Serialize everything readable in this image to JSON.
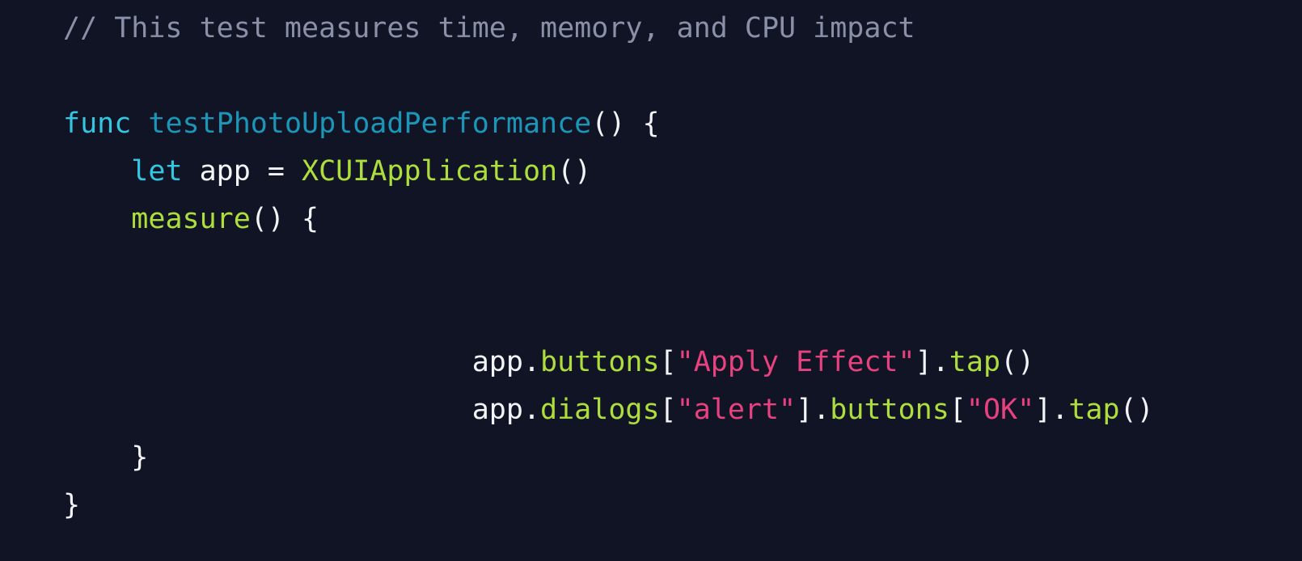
{
  "editor": {
    "background_color": "#111425",
    "font_size_px": 35,
    "line_height_px": 59,
    "language": "swift"
  },
  "theme": {
    "comment_color": "#8b90a8",
    "keyword_color": "#34c5e0",
    "function_name_color": "#1b96b8",
    "method_color": "#aede3c",
    "type_color": "#aede3c",
    "string_color": "#e8417f",
    "plain_color": "#f2f4f8",
    "background_color": "#111425"
  },
  "code": {
    "full_text": "// This test measures time, memory, and CPU impact\n\nfunc testPhotoUploadPerformance() {\n    let app = XCUIApplication()\n    measure() {\n\n\n                        app.buttons[\"Apply Effect\"].tap()\n                        app.dialogs[\"alert\"].buttons[\"OK\"].tap()\n    }\n}",
    "lines": [
      {
        "index": 1,
        "indent": 0,
        "text": "// This test measures time, memory, and CPU impact",
        "tokens": [
          {
            "t": "// This test measures time, memory, and CPU impact",
            "c": "comment"
          }
        ]
      },
      {
        "index": 2,
        "indent": 0,
        "text": "",
        "tokens": []
      },
      {
        "index": 3,
        "indent": 0,
        "text": "func testPhotoUploadPerformance() {",
        "tokens": [
          {
            "t": "func",
            "c": "keyword"
          },
          {
            "t": " ",
            "c": "plain"
          },
          {
            "t": "testPhotoUploadPerformance",
            "c": "function"
          },
          {
            "t": "() {",
            "c": "punct"
          }
        ]
      },
      {
        "index": 4,
        "indent": 4,
        "text": "    let app = XCUIApplication()",
        "tokens": [
          {
            "t": "    ",
            "c": "plain"
          },
          {
            "t": "let",
            "c": "keyword"
          },
          {
            "t": " app = ",
            "c": "plain"
          },
          {
            "t": "XCUIApplication",
            "c": "type"
          },
          {
            "t": "()",
            "c": "punct"
          }
        ]
      },
      {
        "index": 5,
        "indent": 4,
        "text": "    measure() {",
        "tokens": [
          {
            "t": "    ",
            "c": "plain"
          },
          {
            "t": "measure",
            "c": "method"
          },
          {
            "t": "() {",
            "c": "punct"
          }
        ]
      },
      {
        "index": 6,
        "indent": 0,
        "text": "",
        "tokens": []
      },
      {
        "index": 7,
        "indent": 0,
        "text": "",
        "tokens": []
      },
      {
        "index": 8,
        "indent": 24,
        "text": "                        app.buttons[\"Apply Effect\"].tap()",
        "tokens": [
          {
            "t": "                        ",
            "c": "plain"
          },
          {
            "t": "app",
            "c": "plain"
          },
          {
            "t": ".",
            "c": "punct"
          },
          {
            "t": "buttons",
            "c": "method"
          },
          {
            "t": "[",
            "c": "punct"
          },
          {
            "t": "\"Apply Effect\"",
            "c": "string"
          },
          {
            "t": "]",
            "c": "punct"
          },
          {
            "t": ".",
            "c": "punct"
          },
          {
            "t": "tap",
            "c": "method"
          },
          {
            "t": "()",
            "c": "punct"
          }
        ]
      },
      {
        "index": 9,
        "indent": 24,
        "text": "                        app.dialogs[\"alert\"].buttons[\"OK\"].tap()",
        "tokens": [
          {
            "t": "                        ",
            "c": "plain"
          },
          {
            "t": "app",
            "c": "plain"
          },
          {
            "t": ".",
            "c": "punct"
          },
          {
            "t": "dialogs",
            "c": "method"
          },
          {
            "t": "[",
            "c": "punct"
          },
          {
            "t": "\"alert\"",
            "c": "string"
          },
          {
            "t": "]",
            "c": "punct"
          },
          {
            "t": ".",
            "c": "punct"
          },
          {
            "t": "buttons",
            "c": "method"
          },
          {
            "t": "[",
            "c": "punct"
          },
          {
            "t": "\"OK\"",
            "c": "string"
          },
          {
            "t": "]",
            "c": "punct"
          },
          {
            "t": ".",
            "c": "punct"
          },
          {
            "t": "tap",
            "c": "method"
          },
          {
            "t": "()",
            "c": "punct"
          }
        ]
      },
      {
        "index": 10,
        "indent": 4,
        "text": "    }",
        "tokens": [
          {
            "t": "    ",
            "c": "plain"
          },
          {
            "t": "}",
            "c": "punct"
          }
        ]
      },
      {
        "index": 11,
        "indent": 0,
        "text": "}",
        "tokens": [
          {
            "t": "}",
            "c": "punct"
          }
        ]
      }
    ]
  }
}
